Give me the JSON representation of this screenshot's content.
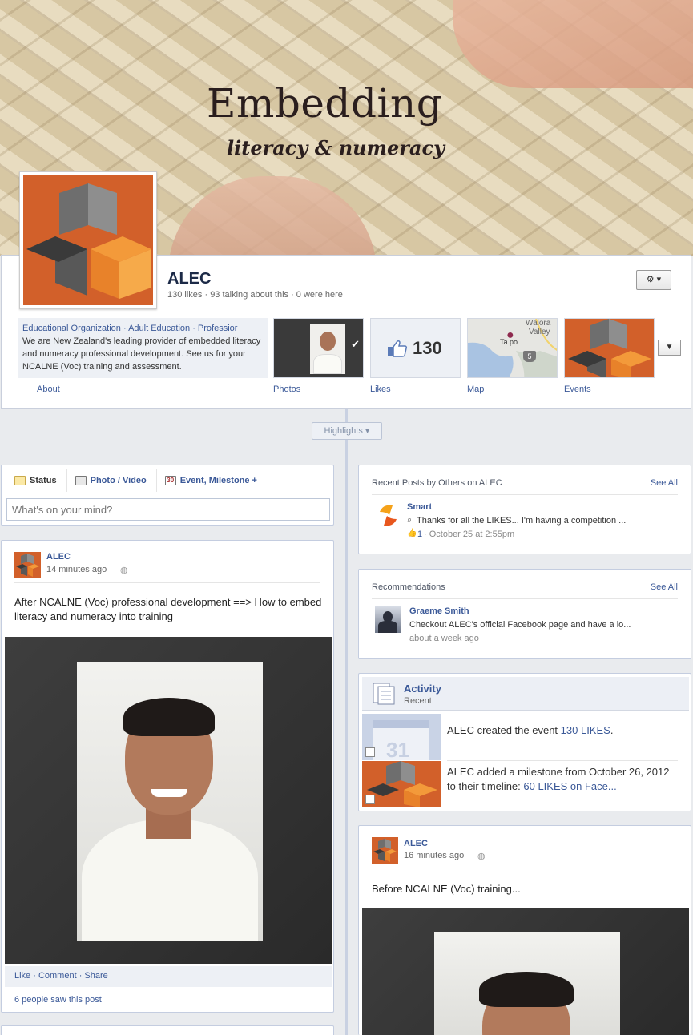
{
  "cover": {
    "title": "Embedding",
    "subtitle": "literacy & numeracy"
  },
  "page": {
    "name": "ALEC",
    "stats": "130 likes · 93 talking about this · 0 were here",
    "gear_label": "⚙ ▾"
  },
  "about": {
    "categories": "Educational Organization · Adult Education · Professior",
    "description": "We are New Zealand's leading provider of embedded literacy and numeracy professional development. See us for your NCALNE (Voc) training and assessment.",
    "label": "About"
  },
  "tabs": [
    {
      "label": "Photos"
    },
    {
      "label": "Likes",
      "count": "130"
    },
    {
      "label": "Map",
      "map_text_1": "Waiora",
      "map_text_2": "Valley",
      "map_text_3": "Ta po",
      "map_badge": "5"
    },
    {
      "label": "Events"
    }
  ],
  "highlights_label": "Highlights ▾",
  "composer": {
    "tabs": [
      {
        "label": "Status",
        "icon": "status-icon"
      },
      {
        "label": "Photo / Video",
        "icon": "photo-icon"
      },
      {
        "label": "Event, Milestone +",
        "icon": "calendar-icon",
        "icon_text": "30"
      }
    ],
    "placeholder": "What's on your mind?"
  },
  "post1": {
    "author": "ALEC",
    "time": "14 minutes ago",
    "text": "After NCALNE (Voc) professional development ==> How to embed literacy and numeracy into training",
    "actions": "Like · Comment · Share",
    "seen": "6 people saw this post"
  },
  "recent_posts": {
    "title": "Recent Posts by Others on ALEC",
    "see_all": "See All",
    "items": [
      {
        "name": "Smart",
        "text": "Thanks for all the LIKES... I'm having a competition ...",
        "likes": "1",
        "date": " · October 25 at 2:55pm"
      }
    ]
  },
  "recommendations": {
    "title": "Recommendations",
    "see_all": "See All",
    "items": [
      {
        "name": "Graeme Smith",
        "text": "Checkout ALEC's official Facebook page and have a lo...",
        "date": "about a week ago"
      }
    ]
  },
  "activity": {
    "title": "Activity",
    "subtitle": "Recent",
    "items": [
      {
        "prefix": "ALEC created the event ",
        "link": "130 LIKES",
        "suffix": ".",
        "thumb_text": "31"
      },
      {
        "prefix": "ALEC added a milestone from October 26, 2012 to their timeline: ",
        "link": "60 LIKES on Face...",
        "suffix": ""
      }
    ]
  },
  "post2": {
    "author": "ALEC",
    "time": "16 minutes ago",
    "text": "Before NCALNE (Voc) training..."
  },
  "colors": {
    "brand_blue": "#3b5998",
    "logo_orange": "#d2602a",
    "background": "#e9ebee"
  }
}
